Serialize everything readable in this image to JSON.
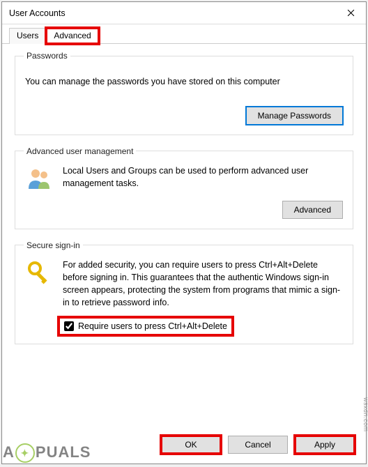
{
  "window": {
    "title": "User Accounts"
  },
  "tabs": {
    "users": "Users",
    "advanced": "Advanced",
    "active": "advanced"
  },
  "groups": {
    "passwords": {
      "legend": "Passwords",
      "text": "You can manage the passwords you have stored on this computer",
      "button": "Manage Passwords"
    },
    "aum": {
      "legend": "Advanced user management",
      "text": "Local Users and Groups can be used to perform advanced user management tasks.",
      "button": "Advanced"
    },
    "secure": {
      "legend": "Secure sign-in",
      "text": "For added security, you can require users to press Ctrl+Alt+Delete before signing in. This guarantees that the authentic Windows sign-in screen appears, protecting the system from programs that mimic a sign-in to retrieve password info.",
      "checkbox_label": "Require users to press Ctrl+Alt+Delete",
      "checkbox_checked": true
    }
  },
  "buttons": {
    "ok": "OK",
    "cancel": "Cancel",
    "apply": "Apply"
  },
  "watermark": {
    "left": "A",
    "right": "PUALS",
    "side": "wsxdn.com"
  },
  "icons": {
    "close": "close-icon",
    "users": "users-icon",
    "key": "key-icon"
  }
}
